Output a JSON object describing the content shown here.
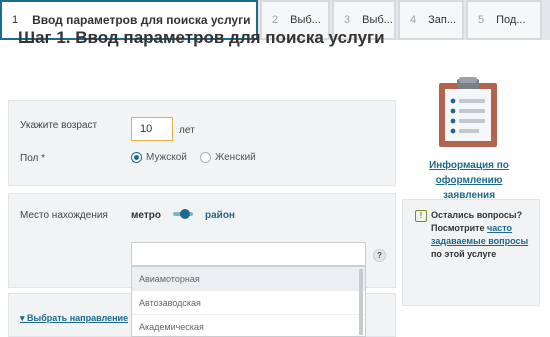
{
  "steps": [
    {
      "num": "1",
      "label": "Ввод параметров для поиска услуги"
    },
    {
      "num": "2",
      "label": "Выб..."
    },
    {
      "num": "3",
      "label": "Выб..."
    },
    {
      "num": "4",
      "label": "Зап..."
    },
    {
      "num": "5",
      "label": "Под..."
    }
  ],
  "title": "Шаг 1. Ввод параметров для поиска услуги",
  "age": {
    "label": "Укажите возраст",
    "value": "10",
    "unit": "лет"
  },
  "gender": {
    "label": "Пол *",
    "options": [
      "Мужской",
      "Женский"
    ],
    "selected": "Мужской"
  },
  "location": {
    "label": "Место нахождения",
    "option_metro": "метро",
    "option_district": "район"
  },
  "help_icon": "?",
  "stations": [
    "Авиамоторная",
    "Автозаводская",
    "Академическая"
  ],
  "collapse_link": "Выбрать направление",
  "info": {
    "line1": "Информация по",
    "line2": "оформлению заявления",
    "icon": "clipboard-icon"
  },
  "questions": {
    "icon": "!",
    "text1": "Остались вопросы? Посмотрите ",
    "link": "часто задаваемые вопросы",
    "text2": " по этой услуге"
  },
  "colors": {
    "accent": "#1d6a8e",
    "clipboard": "#b2654c",
    "warning": "#7a8d2c"
  }
}
